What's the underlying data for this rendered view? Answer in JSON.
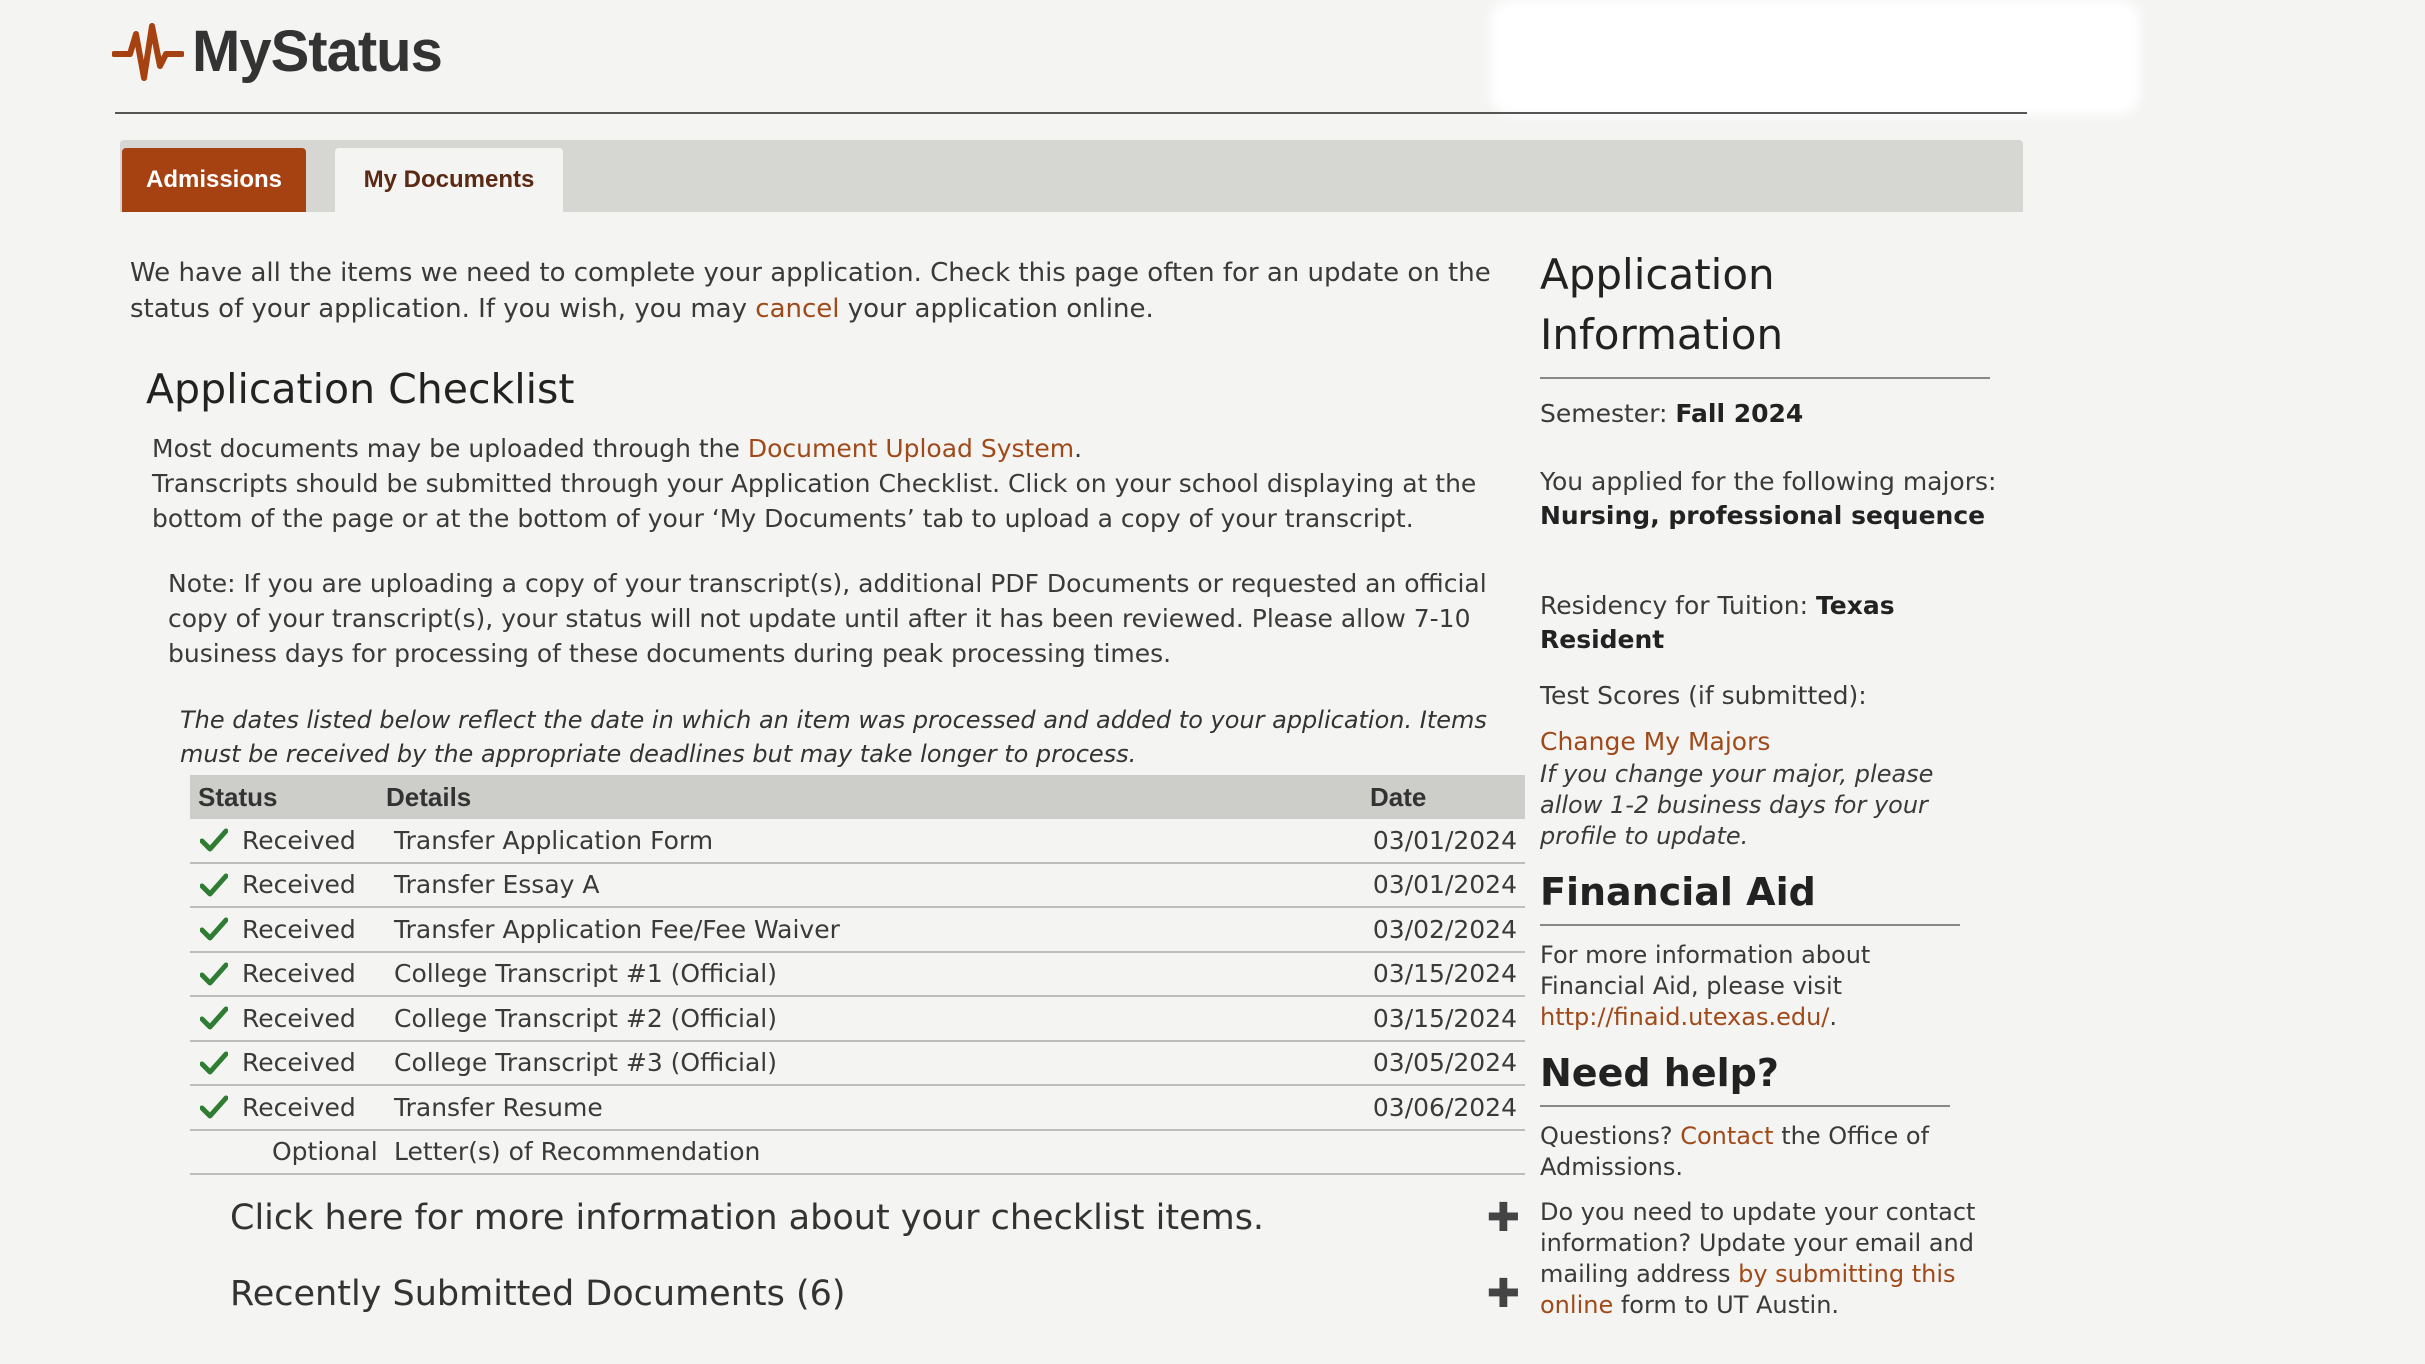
{
  "app": {
    "title": "MyStatus"
  },
  "tabs": [
    {
      "label": "Admissions",
      "active": true
    },
    {
      "label": "My Documents",
      "active": false
    }
  ],
  "intro": {
    "text_before": "We have all the items we need to complete your application. Check this page often for an update on the status of your application. If you wish, you may ",
    "cancel_link": "cancel",
    "text_after": " your application online."
  },
  "checklist": {
    "heading": "Application Checklist",
    "upload_before": "Most documents may be uploaded through the ",
    "upload_link": "Document Upload System",
    "upload_after": ".",
    "transcripts": "Transcripts should be submitted through your Application Checklist. Click on your school displaying at the bottom of the page or at the bottom of your ‘My Documents’ tab to upload a copy of your transcript.",
    "note": "Note: If you are uploading a copy of your transcript(s), additional PDF Documents or requested an official copy of your transcript(s), your status will not update until after it has been reviewed. Please allow 7-10 business days for processing of these documents during peak processing times.",
    "dates_note": "The dates listed below reflect the date in which an item was processed and added to your application. Items must be received by the appropriate deadlines but may take longer to process.",
    "columns": {
      "status": "Status",
      "details": "Details",
      "date": "Date"
    },
    "rows": [
      {
        "status": "Received",
        "details": "Transfer Application Form",
        "date": "03/01/2024"
      },
      {
        "status": "Received",
        "details": "Transfer Essay A",
        "date": "03/01/2024"
      },
      {
        "status": "Received",
        "details": "Transfer Application Fee/Fee Waiver",
        "date": "03/02/2024"
      },
      {
        "status": "Received",
        "details": "College Transcript #1 (Official)",
        "date": "03/15/2024"
      },
      {
        "status": "Received",
        "details": "College Transcript #2 (Official)",
        "date": "03/15/2024"
      },
      {
        "status": "Received",
        "details": "College Transcript #3 (Official)",
        "date": "03/05/2024"
      },
      {
        "status": "Received",
        "details": "Transfer Resume",
        "date": "03/06/2024"
      },
      {
        "status": "Optional",
        "details": "Letter(s) of Recommendation",
        "date": ""
      }
    ],
    "more_info": "Click here for more information about your checklist items.",
    "recent_docs": "Recently Submitted Documents (6)"
  },
  "sidebar": {
    "app_info_heading": "Application Information",
    "semester_label": "Semester: ",
    "semester_value": "Fall 2024",
    "majors_label": "You applied for the following majors:",
    "majors_value": "Nursing, professional sequence",
    "residency_label": "Residency for Tuition: ",
    "residency_value": "Texas Resident",
    "test_scores": "Test Scores (if submitted):",
    "change_majors_link": "Change My Majors",
    "change_majors_note": "If you change your major, please allow 1-2 business days for your profile to update.",
    "financial_aid_heading": "Financial Aid",
    "financial_aid_text": "For more information about Financial Aid, please visit ",
    "financial_aid_link": "http://finaid.utexas.edu/",
    "financial_aid_after": ".",
    "help_heading": "Need help?",
    "questions_before": "Questions? ",
    "contact_link": "Contact",
    "questions_after": " the Office of Admissions.",
    "update_before": "Do you need to update your contact information? Update your email and mailing address ",
    "update_link": "by submitting this online",
    "update_after": " form to UT Austin."
  },
  "colors": {
    "accent": "#a64211",
    "link": "#a04a1a",
    "check": "#2e7d32"
  }
}
